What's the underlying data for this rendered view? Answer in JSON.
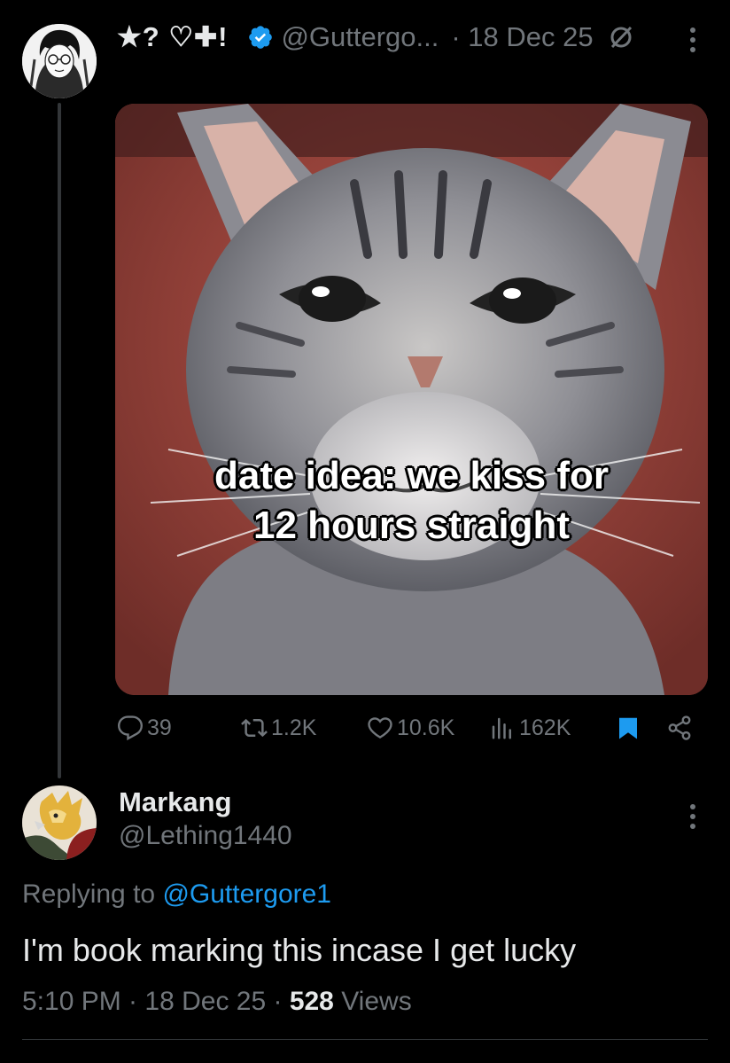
{
  "tweet": {
    "display_name": "★? ♡✚!",
    "handle": "@Guttergo...",
    "time": "· 18 Dec 25",
    "media": {
      "caption_line1": "date idea: we kiss for",
      "caption_line2": "12 hours straight"
    },
    "stats": {
      "replies": "39",
      "reposts": "1.2K",
      "likes": "10.6K",
      "views": "162K"
    }
  },
  "reply": {
    "display_name": "Markang",
    "handle": "@Lething1440",
    "replying_to_prefix": "Replying to",
    "replying_to_handle": "@Guttergore1",
    "text": "I'm book marking this incase I get lucky",
    "time": "5:10 PM · 18 Dec 25 ·",
    "views_count": "528",
    "views_label": "Views"
  },
  "colors": {
    "background": "#000000",
    "text_primary": "#e7e9ea",
    "text_secondary": "#71767b",
    "accent": "#1d9bf0"
  },
  "icons": [
    "verified-badge-icon",
    "grok-icon",
    "more-icon",
    "reply-icon",
    "retweet-icon",
    "like-icon",
    "views-icon",
    "bookmark-icon",
    "share-icon"
  ]
}
